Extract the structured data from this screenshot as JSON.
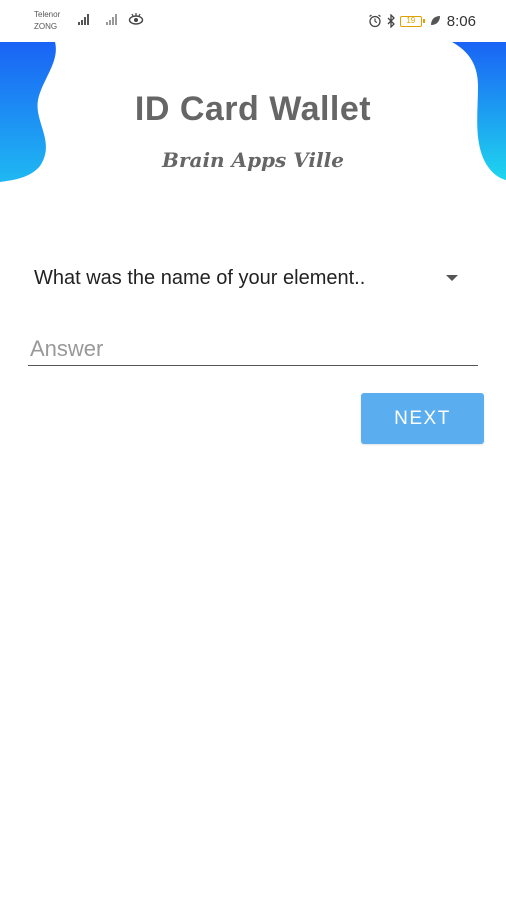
{
  "status_bar": {
    "carrier_1": "Telenor",
    "carrier_2": "ZONG",
    "battery_level": "19",
    "time": "8:06"
  },
  "header": {
    "title": "ID Card Wallet",
    "subtitle": "Brain Apps Ville"
  },
  "form": {
    "question_selected": "What was the name of your element..",
    "answer_placeholder": "Answer",
    "answer_value": "",
    "next_label": "NEXT"
  },
  "colors": {
    "wave_gradient_start": "#1a63f5",
    "wave_gradient_end": "#1fd6ee",
    "next_button": "#5aaef0",
    "title_text": "#666666"
  }
}
